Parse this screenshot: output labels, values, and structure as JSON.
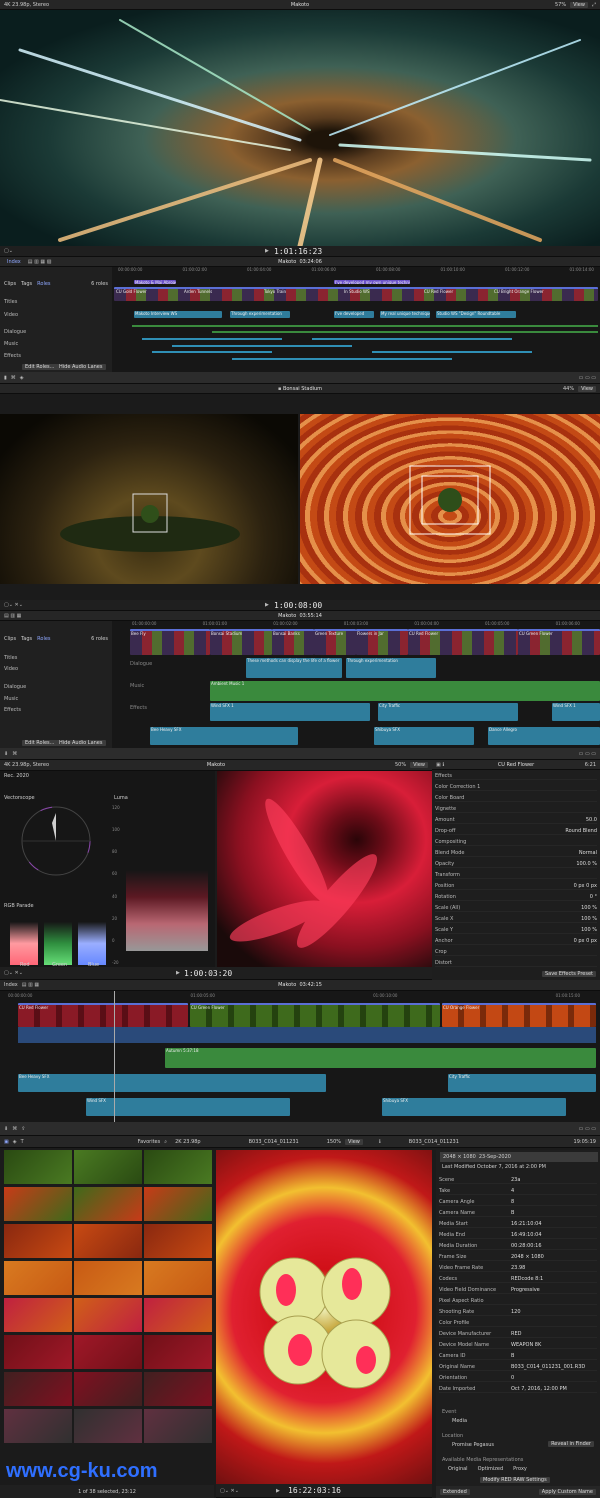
{
  "p1": {
    "format": "4K 23.98p, Stereo",
    "title": "Makoto",
    "zoom": "57%",
    "view": "View",
    "timecode": "1:01:16:23",
    "index": "Index",
    "tl_title": "Makoto",
    "tl_dur": "03:24:06",
    "ruler": [
      "00:00:00:00",
      "01:00:02:00",
      "01:00:04:00",
      "01:00:06:00",
      "01:00:08:00",
      "01:00:10:00",
      "01:00:12:00",
      "01:00:14:00"
    ],
    "tabs": [
      "Clips",
      "Tags",
      "Roles"
    ],
    "items": "6 roles",
    "roles": [
      "Titles",
      "Video",
      "Dialogue",
      "Music",
      "Effects"
    ],
    "buttons": [
      "Edit Roles...",
      "Hide Audio Lanes"
    ],
    "clips": [
      "Makoto & Mai Abroad",
      "CU Gold Flower",
      "Arden Tunnels",
      "Tunnel Ext",
      "Tokyo Train",
      "Full Shot",
      "In Studio WS",
      "Cleaning Lady",
      "CU Red Flower",
      "CU Bright Orange Flower",
      "Outtakes"
    ],
    "titles": [
      "Wanted a little warning",
      "I've developed my own unique technique...",
      "Makoto Interview WS",
      "Through experimentation",
      "I've developed",
      "My real unique technique",
      "Studio WS \"Design\" Roundtable"
    ]
  },
  "p2": {
    "title": "Bonsai Stadium",
    "zoom": "44%",
    "view": "View",
    "timecode": "1:00:08:00",
    "tl_title": "Makoto",
    "tl_dur": "03:55:14",
    "ruler": [
      "01:00:00:00",
      "01:00:01:00",
      "01:00:02:00",
      "01:00:03:00",
      "01:00:04:00",
      "01:00:05:00",
      "01:00:06:00"
    ],
    "tabs": [
      "Clips",
      "Tags",
      "Roles"
    ],
    "items": "6 roles",
    "roles": [
      "Titles",
      "Video",
      "Dialogue",
      "Music",
      "Effects"
    ],
    "buttons": [
      "Edit Roles...",
      "Hide Audio Lanes"
    ],
    "clips": [
      "Bonsai Stadium",
      "Bonsai Banks",
      "Green Texture",
      "Flowers in Jar",
      "CU Red Flower",
      "CU Green Flower",
      "Bee Fly"
    ],
    "lanes": [
      "Dialogue",
      "Music",
      "Effects"
    ],
    "audio": [
      "These methods can display the life of a flower",
      "Through experimentation",
      "Ambient Music 1",
      "Wind SFX 1",
      "City Traffic",
      "Wind SFX 1",
      "Bee Heavy SFX",
      "Shibuya SFX",
      "Dance Allegro"
    ]
  },
  "p3": {
    "format": "4K 23.98p, Stereo",
    "title": "Makoto",
    "zoom": "50%",
    "view": "View",
    "timecode": "1:00:03:20",
    "date": "Rec. 2020",
    "scope1": "Vectorscope",
    "scope2": "RGB Parade",
    "luma": "Luma",
    "luma_ticks": [
      "120",
      "100",
      "80",
      "60",
      "40",
      "20",
      "0",
      "-20"
    ],
    "parade_labels": [
      "Red",
      "Green",
      "Blue"
    ],
    "insp_title": "CU Red Flower",
    "insp_time": "6:21",
    "insp": [
      [
        "Effects",
        ""
      ],
      [
        "Color Correction 1",
        ""
      ],
      [
        "Color Board",
        ""
      ],
      [
        "Vignette",
        ""
      ],
      [
        "Amount",
        "50.0"
      ],
      [
        "Drop-off",
        "Round Blend"
      ],
      [
        "Compositing",
        ""
      ],
      [
        "Blend Mode",
        "Normal"
      ],
      [
        "Opacity",
        "100.0 %"
      ],
      [
        "Transform",
        ""
      ],
      [
        "Position",
        "0 px   0 px"
      ],
      [
        "Rotation",
        "0 °"
      ],
      [
        "Scale (All)",
        "100 %"
      ],
      [
        "Scale X",
        "100 %"
      ],
      [
        "Scale Y",
        "100 %"
      ],
      [
        "Anchor",
        "0 px   0 px"
      ],
      [
        "Crop",
        ""
      ],
      [
        "Distort",
        ""
      ]
    ],
    "save": "Save Effects Preset"
  },
  "p4": {
    "index": "Index",
    "title": "Makoto",
    "dur": "03:42:15",
    "ruler": [
      "00:00:00:00",
      "01:00:05:00",
      "01:00:10:00",
      "01:00:15:00"
    ],
    "clips": [
      "CU Red Flower",
      "CU Green Flower",
      "CU Orange Flower"
    ],
    "audio": [
      "Autumn 5:37:18",
      "Bee Heavy SFX",
      "City Traffic",
      "Wind SFX",
      "Shibuya SFX"
    ]
  },
  "p5": {
    "favorites": "Favorites",
    "format": "2K 23.98p",
    "clip": "B033_C014_011231",
    "zoom": "150%",
    "view": "View",
    "timecode": "16:22:03:16",
    "insp_title": "B033_C014_011231",
    "insp_time": "19:05:19",
    "res": "2048 × 1080",
    "date": "23-Sep-2020",
    "modified": "Last Modified October 7, 2016 at 2:00 PM",
    "meta": [
      [
        "Scene",
        "23a"
      ],
      [
        "Take",
        "4"
      ],
      [
        "Camera Angle",
        "8"
      ],
      [
        "Camera Name",
        "B"
      ],
      [
        "Media Start",
        "16:21:10:04"
      ],
      [
        "Media End",
        "16:49:10:04"
      ],
      [
        "Media Duration",
        "00:28:00:16"
      ],
      [
        "Frame Size",
        "2048 × 1080"
      ],
      [
        "Video Frame Rate",
        "23.98"
      ],
      [
        "Codecs",
        "REDcode 8:1"
      ],
      [
        "Video Field Dominance",
        "Progressive"
      ],
      [
        "Pixel Aspect Ratio",
        ""
      ],
      [
        "Shooting Rate",
        "120"
      ],
      [
        "Color Profile",
        ""
      ],
      [
        "Device Manufacturer",
        "RED"
      ],
      [
        "Device Model Name",
        "WEAPON 8K"
      ],
      [
        "Camera ID",
        "B"
      ],
      [
        "Original Name",
        "B033_C014_011231_001.R3D"
      ],
      [
        "Orientation",
        "0"
      ],
      [
        "Date Imported",
        "Oct 7, 2016, 12:00 PM"
      ]
    ],
    "event": "Event",
    "event_v": "Media",
    "location": "Location",
    "location_v": "Promise Pegasus",
    "reveal": "Reveal in Finder",
    "reps": "Available Media Representations",
    "rep_list": [
      "Original",
      "Optimized",
      "Proxy"
    ],
    "modify": "Modify RED RAW Settings",
    "footer": "1 of 38 selected, 23:12",
    "extended": "Extended",
    "apply": "Apply Custom Name",
    "watermark": "www.cg-ku.com"
  }
}
